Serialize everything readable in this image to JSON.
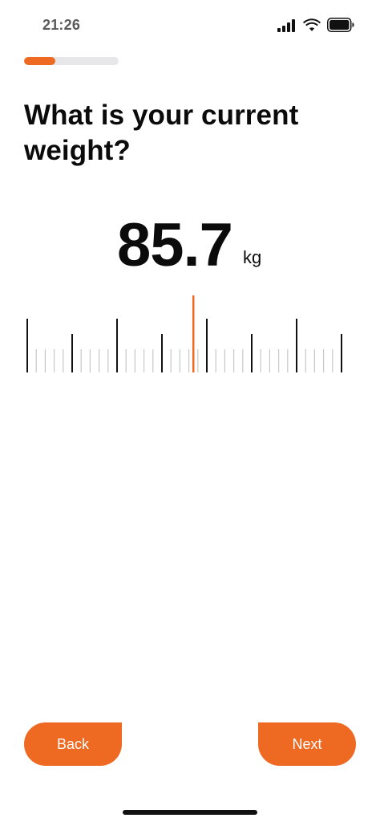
{
  "status_bar": {
    "time": "21:26",
    "icons": [
      "signal-icon",
      "wifi-icon",
      "battery-icon"
    ]
  },
  "onboarding": {
    "progress_fraction": 0.33,
    "title": "What is your current weight?"
  },
  "weight_picker": {
    "value": "85.7",
    "unit": "kg",
    "selected_value": 85.7,
    "min_visible": 82.0,
    "max_visible": 89.0,
    "major_every": 1.0,
    "minor_step": 0.1
  },
  "buttons": {
    "back_label": "Back",
    "next_label": "Next"
  },
  "colors": {
    "accent": "#ee6a22",
    "text": "#0b0b0b",
    "track": "#e7e7ea",
    "minor_tick": "#c8c8c8",
    "major_tick": "#111111"
  }
}
